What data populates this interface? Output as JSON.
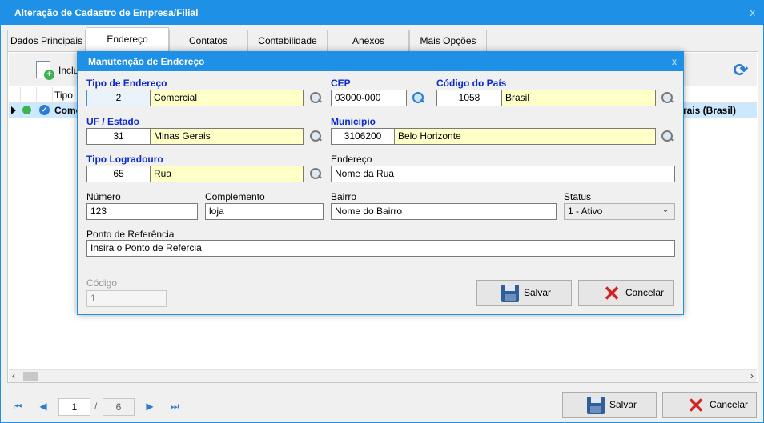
{
  "outer": {
    "title": "Alteração de Cadastro de Empresa/Filial",
    "close": "x",
    "tabs": [
      {
        "label": "Dados Principais"
      },
      {
        "label": "Endereço"
      },
      {
        "label": "Contatos"
      },
      {
        "label": "Contabilidade"
      },
      {
        "label": "Anexos"
      },
      {
        "label": "Mais Opções"
      }
    ],
    "active_tab": "Endereço",
    "toolbar": {
      "include_label": "Inclu"
    },
    "grid": {
      "column_tipo": "Tipo",
      "row": {
        "tipo": "Come",
        "right_text": "rais (Brasil)"
      }
    },
    "pager": {
      "current_page": "1",
      "separator": "/",
      "total_pages": "6"
    },
    "save_label": "Salvar",
    "cancel_label": "Cancelar"
  },
  "modal": {
    "title": "Manutenção de Endereço",
    "close": "x",
    "tipo_endereco": {
      "label": "Tipo de Endereço",
      "code": "2",
      "desc": "Comercial"
    },
    "cep": {
      "label": "CEP",
      "value": "03000-000"
    },
    "codigo_pais": {
      "label": "Código do País",
      "code": "1058",
      "desc": "Brasil"
    },
    "uf_estado": {
      "label": "UF / Estado",
      "code": "31",
      "desc": "Minas Gerais"
    },
    "municipio": {
      "label": "Municipio",
      "code": "3106200",
      "desc": "Belo Horizonte"
    },
    "tipo_logradouro": {
      "label": "Tipo Logradouro",
      "code": "65",
      "desc": "Rua"
    },
    "endereco": {
      "label": "Endereço",
      "value": "Nome da Rua"
    },
    "numero": {
      "label": "Número",
      "value": "123"
    },
    "complemento": {
      "label": "Complemento",
      "value": "loja"
    },
    "bairro": {
      "label": "Bairro",
      "value": "Nome do Bairro"
    },
    "status": {
      "label": "Status",
      "value": "1 - Ativo"
    },
    "ponto_referencia": {
      "label": "Ponto de Referência",
      "value": "Insira o Ponto de Refercia"
    },
    "codigo": {
      "label": "Código",
      "value": "1"
    },
    "save_label": "Salvar",
    "cancel_label": "Cancelar"
  },
  "colors": {
    "accent": "#1e90e6",
    "required_label": "#0a2acc",
    "lookup_field": "#ffffc8",
    "selected_row": "#cce8ff"
  },
  "icons": [
    "include-document-icon",
    "refresh-icon",
    "magnifier-icon",
    "save-disk-icon",
    "cancel-x-icon",
    "first-page-icon",
    "previous-page-icon",
    "next-page-icon",
    "last-page-icon"
  ]
}
